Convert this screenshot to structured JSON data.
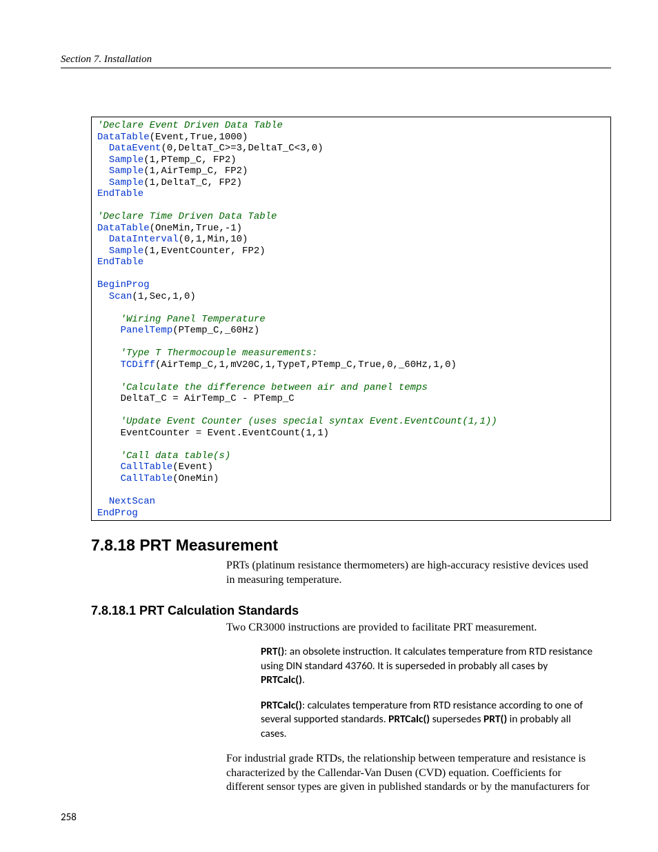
{
  "header": {
    "running": "Section 7.  Installation"
  },
  "code": {
    "c1": "'Declare Event Driven Data Table",
    "l1a": "DataTable",
    "l1b": "(Event,True,1000)",
    "l2a": "DataEvent",
    "l2b": "(0,DeltaT_C>=3,DeltaT_C<3,0)",
    "l3a": "Sample",
    "l3b": "(1,PTemp_C, FP2)",
    "l4a": "Sample",
    "l4b": "(1,AirTemp_C, FP2)",
    "l5a": "Sample",
    "l5b": "(1,DeltaT_C, FP2)",
    "l6": "EndTable",
    "c2": "'Declare Time Driven Data Table",
    "l7a": "DataTable",
    "l7b": "(OneMin,True,-1)",
    "l8a": "DataInterval",
    "l8b": "(0,1,Min,10)",
    "l9a": "Sample",
    "l9b": "(1,EventCounter, FP2)",
    "l10": "EndTable",
    "l11": "BeginProg",
    "l12a": "Scan",
    "l12b": "(1,Sec,1,0)",
    "c3": "'Wiring Panel Temperature",
    "l13a": "PanelTemp",
    "l13b": "(PTemp_C,_60Hz)",
    "c4": "'Type T Thermocouple measurements:",
    "l14a": "TCDiff",
    "l14b": "(AirTemp_C,1,mV20C,1,TypeT,PTemp_C,True,0,_60Hz,1,0)",
    "c5": "'Calculate the difference between air and panel temps",
    "l15": "DeltaT_C = AirTemp_C - PTemp_C",
    "c6": "'Update Event Counter (uses special syntax Event.EventCount(1,1))",
    "l16": "EventCounter = Event.EventCount(1,1)",
    "c7": "'Call data table(s)",
    "l17a": "CallTable",
    "l17b": "(Event)",
    "l18a": "CallTable",
    "l18b": "(OneMin)",
    "l19": "NextScan",
    "l20": "EndProg"
  },
  "s18": {
    "title": "7.8.18 PRT Measurement",
    "intro": "PRTs (platinum resistance thermometers) are high-accuracy resistive devices used in measuring temperature."
  },
  "s181": {
    "title": "7.8.18.1 PRT Calculation Standards",
    "intro": "Two CR3000 instructions are provided to facilitate PRT measurement.",
    "b1_bold": "PRT()",
    "b1_rest": ": an obsolete instruction.  It calculates temperature from RTD resistance using DIN standard 43760.  It is superseded in probably all cases by ",
    "b1_bold2": "PRTCalc()",
    "b1_tail": ".",
    "b2_bold": "PRTCalc()",
    "b2_rest": ": calculates temperature from RTD resistance according to one of several supported standards.  ",
    "b2_bold2": "PRTCalc()",
    "b2_mid": " supersedes ",
    "b2_bold3": "PRT()",
    "b2_tail": " in probably all cases.",
    "para2": "For industrial grade RTDs, the relationship between temperature and resistance is characterized by the Callendar-Van Dusen (CVD) equation.  Coefficients for different sensor types are given in published standards or by the manufacturers for"
  },
  "page_number": "258"
}
